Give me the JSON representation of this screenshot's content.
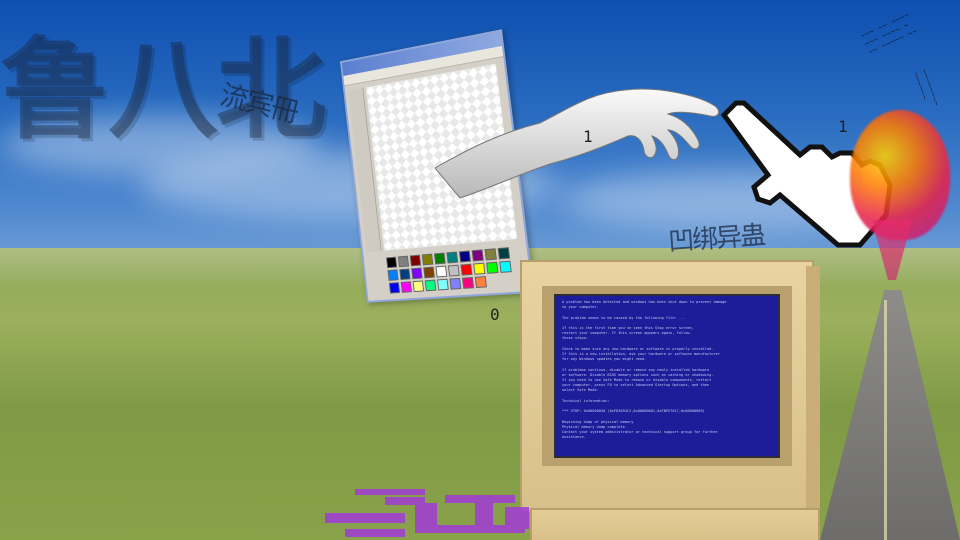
{
  "scene": {
    "big_glyphs": "鲁八北",
    "glitch_strip_1": "流宾冊",
    "glitch_strip_2": "流宾",
    "glitch_strip_3": "凹绑异蛊",
    "digit_1": "1",
    "digit_0": "0",
    "digit_1b": "1"
  },
  "bsod": {
    "lines": [
      "A problem has been detected and windows has been shut down to prevent damage",
      "to your computer.",
      "",
      "The problem seems to be caused by the following file: ...",
      "",
      "If this is the first time you've seen this Stop error screen,",
      "restart your computer. If this screen appears again, follow",
      "these steps:",
      "",
      "Check to make sure any new hardware or software is properly installed.",
      "If this is a new installation, ask your hardware or software manufacturer",
      "for any Windows updates you might need.",
      "",
      "If problems continue, disable or remove any newly installed hardware",
      "or software. Disable BIOS memory options such as caching or shadowing.",
      "If you need to use Safe Mode to remove or disable components, restart",
      "your computer, press F8 to select Advanced Startup Options, and then",
      "select Safe Mode.",
      "",
      "Technical information:",
      "",
      "*** STOP: 0x00000050 (0xFD3094C2,0x00000001,0xFBFE7617,0x00000000)",
      "",
      "Beginning dump of physical memory",
      "Physical memory dump complete.",
      "Contact your system administrator or technical support group for further",
      "assistance."
    ]
  },
  "colors": {
    "sky": "#1f5fb5",
    "field": "#8ea85a",
    "bsod_blue": "#1d1d9a",
    "pc_beige": "#e8d4a0",
    "purple_glitch": "#a23ad6"
  },
  "palette": [
    "#000000",
    "#808080",
    "#800000",
    "#808000",
    "#008000",
    "#008080",
    "#000080",
    "#800080",
    "#808040",
    "#004040",
    "#0080ff",
    "#004080",
    "#8000ff",
    "#804000",
    "#ffffff",
    "#c0c0c0",
    "#ff0000",
    "#ffff00",
    "#00ff00",
    "#00ffff",
    "#0000ff",
    "#ff00ff",
    "#ffff80",
    "#00ff80",
    "#80ffff",
    "#8080ff",
    "#ff0080",
    "#ff8040"
  ]
}
